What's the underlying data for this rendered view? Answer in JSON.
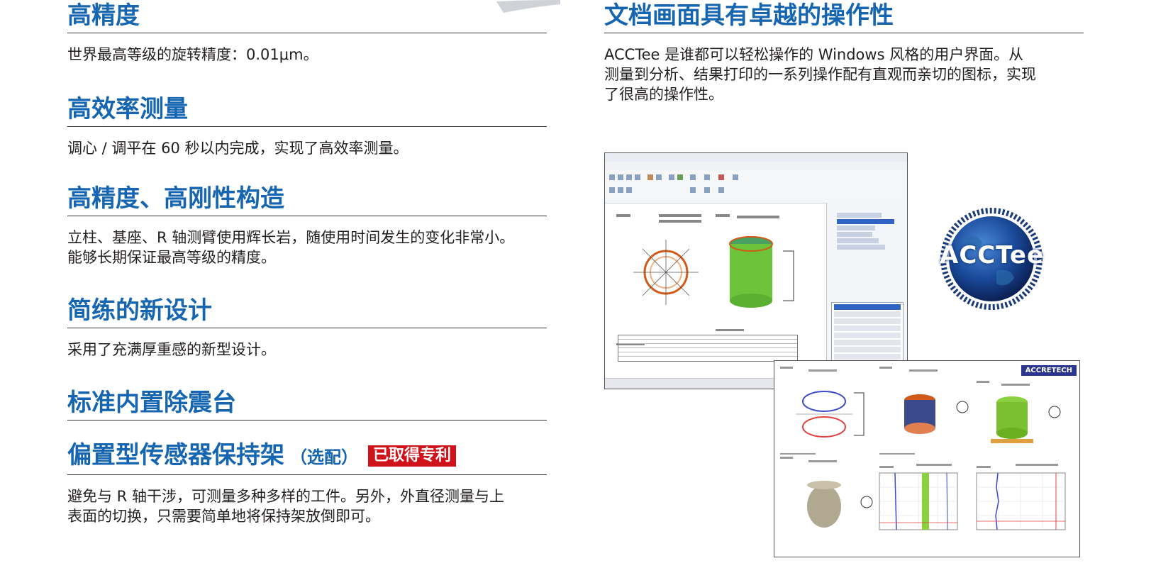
{
  "left": {
    "sections": [
      {
        "title": "高精度",
        "body": [
          "世界最高等级的旋转精度：0.01μm。"
        ]
      },
      {
        "title": "高效率测量",
        "body": [
          "调心 / 调平在 60 秒以内完成，实现了高效率测量。"
        ]
      },
      {
        "title": "高精度、高刚性构造",
        "body": [
          "立柱、基座、R 轴测臂使用辉长岩，随使用时间发生的变化非常小。",
          "能够长期保证最高等级的精度。"
        ]
      },
      {
        "title": "简练的新设计",
        "body": [
          "采用了充满厚重感的新型设计。"
        ]
      },
      {
        "title": "标准内置除震台",
        "body": []
      },
      {
        "title": "偏置型传感器保持架",
        "subtitle": "（选配）",
        "badge": "已取得专利",
        "body": [
          "避免与 R 轴干涉，可测量多种多样的工件。另外，外直径测量与上",
          "表面的切换，只需要简单地将保持架放倒即可。"
        ]
      }
    ]
  },
  "right": {
    "title": "文档画面具有卓越的操作性",
    "body": [
      "ACCTee 是谁都可以轻松操作的 Windows 风格的用户界面。从",
      "测量到分析、结果打印的一系列操作配有直观而亲切的图标，实现",
      "了很高的操作性。"
    ]
  },
  "logo": {
    "text": "ACCTee",
    "ring_text": "SURECOM CONTOUR"
  },
  "report_logo": "ACCRETECH",
  "colors": {
    "heading": "#1565b0",
    "badge": "#d0121b",
    "text": "#231f20"
  }
}
